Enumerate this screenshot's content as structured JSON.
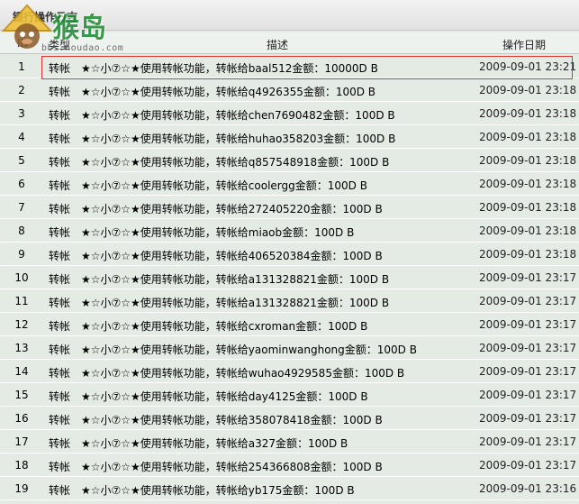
{
  "panel": {
    "title": "银行操作日志"
  },
  "watermark": {
    "logo_text": "猴岛",
    "url_text": "bbs.houdao.com"
  },
  "table": {
    "columns": [
      "ID",
      "类型",
      "描述",
      "操作日期"
    ],
    "rows": [
      {
        "id": "1",
        "type": "转帐",
        "desc": "★☆小⑦☆★使用转帐功能，转帐给baal512金额：10000D B",
        "date": "2009-09-01 23:21"
      },
      {
        "id": "2",
        "type": "转帐",
        "desc": "★☆小⑦☆★使用转帐功能，转帐给q4926355金额：100D B",
        "date": "2009-09-01 23:18"
      },
      {
        "id": "3",
        "type": "转帐",
        "desc": "★☆小⑦☆★使用转帐功能，转帐给chen7690482金额：100D B",
        "date": "2009-09-01 23:18"
      },
      {
        "id": "4",
        "type": "转帐",
        "desc": "★☆小⑦☆★使用转帐功能，转帐给huhao358203金额：100D B",
        "date": "2009-09-01 23:18"
      },
      {
        "id": "5",
        "type": "转帐",
        "desc": "★☆小⑦☆★使用转帐功能，转帐给q857548918金额：100D B",
        "date": "2009-09-01 23:18"
      },
      {
        "id": "6",
        "type": "转帐",
        "desc": "★☆小⑦☆★使用转帐功能，转帐给coolergg金额：100D B",
        "date": "2009-09-01 23:18"
      },
      {
        "id": "7",
        "type": "转帐",
        "desc": "★☆小⑦☆★使用转帐功能，转帐给272405220金额：100D B",
        "date": "2009-09-01 23:18"
      },
      {
        "id": "8",
        "type": "转帐",
        "desc": "★☆小⑦☆★使用转帐功能，转帐给miaob金额：100D B",
        "date": "2009-09-01 23:18"
      },
      {
        "id": "9",
        "type": "转帐",
        "desc": "★☆小⑦☆★使用转帐功能，转帐给406520384金额：100D B",
        "date": "2009-09-01 23:18"
      },
      {
        "id": "10",
        "type": "转帐",
        "desc": "★☆小⑦☆★使用转帐功能，转帐给a131328821金额：100D B",
        "date": "2009-09-01 23:17"
      },
      {
        "id": "11",
        "type": "转帐",
        "desc": "★☆小⑦☆★使用转帐功能，转帐给a131328821金额：100D B",
        "date": "2009-09-01 23:17"
      },
      {
        "id": "12",
        "type": "转帐",
        "desc": "★☆小⑦☆★使用转帐功能，转帐给cxroman金额：100D B",
        "date": "2009-09-01 23:17"
      },
      {
        "id": "13",
        "type": "转帐",
        "desc": "★☆小⑦☆★使用转帐功能，转帐给yaominwanghong金额：100D B",
        "date": "2009-09-01 23:17"
      },
      {
        "id": "14",
        "type": "转帐",
        "desc": "★☆小⑦☆★使用转帐功能，转帐给wuhao4929585金额：100D B",
        "date": "2009-09-01 23:17"
      },
      {
        "id": "15",
        "type": "转帐",
        "desc": "★☆小⑦☆★使用转帐功能，转帐给day4125金额：100D B",
        "date": "2009-09-01 23:17"
      },
      {
        "id": "16",
        "type": "转帐",
        "desc": "★☆小⑦☆★使用转帐功能，转帐给358078418金额：100D B",
        "date": "2009-09-01 23:17"
      },
      {
        "id": "17",
        "type": "转帐",
        "desc": "★☆小⑦☆★使用转帐功能，转帐给a327金额：100D B",
        "date": "2009-09-01 23:17"
      },
      {
        "id": "18",
        "type": "转帐",
        "desc": "★☆小⑦☆★使用转帐功能，转帐给254366808金额：100D B",
        "date": "2009-09-01 23:17"
      },
      {
        "id": "19",
        "type": "转帐",
        "desc": "★☆小⑦☆★使用转帐功能，转帐给yb175金额：100D B",
        "date": "2009-09-01 23:16"
      }
    ]
  },
  "colors": {
    "row_bg": "#e4ebe4",
    "highlight_border": "#dd3333",
    "logo_green": "#1b8a30"
  }
}
